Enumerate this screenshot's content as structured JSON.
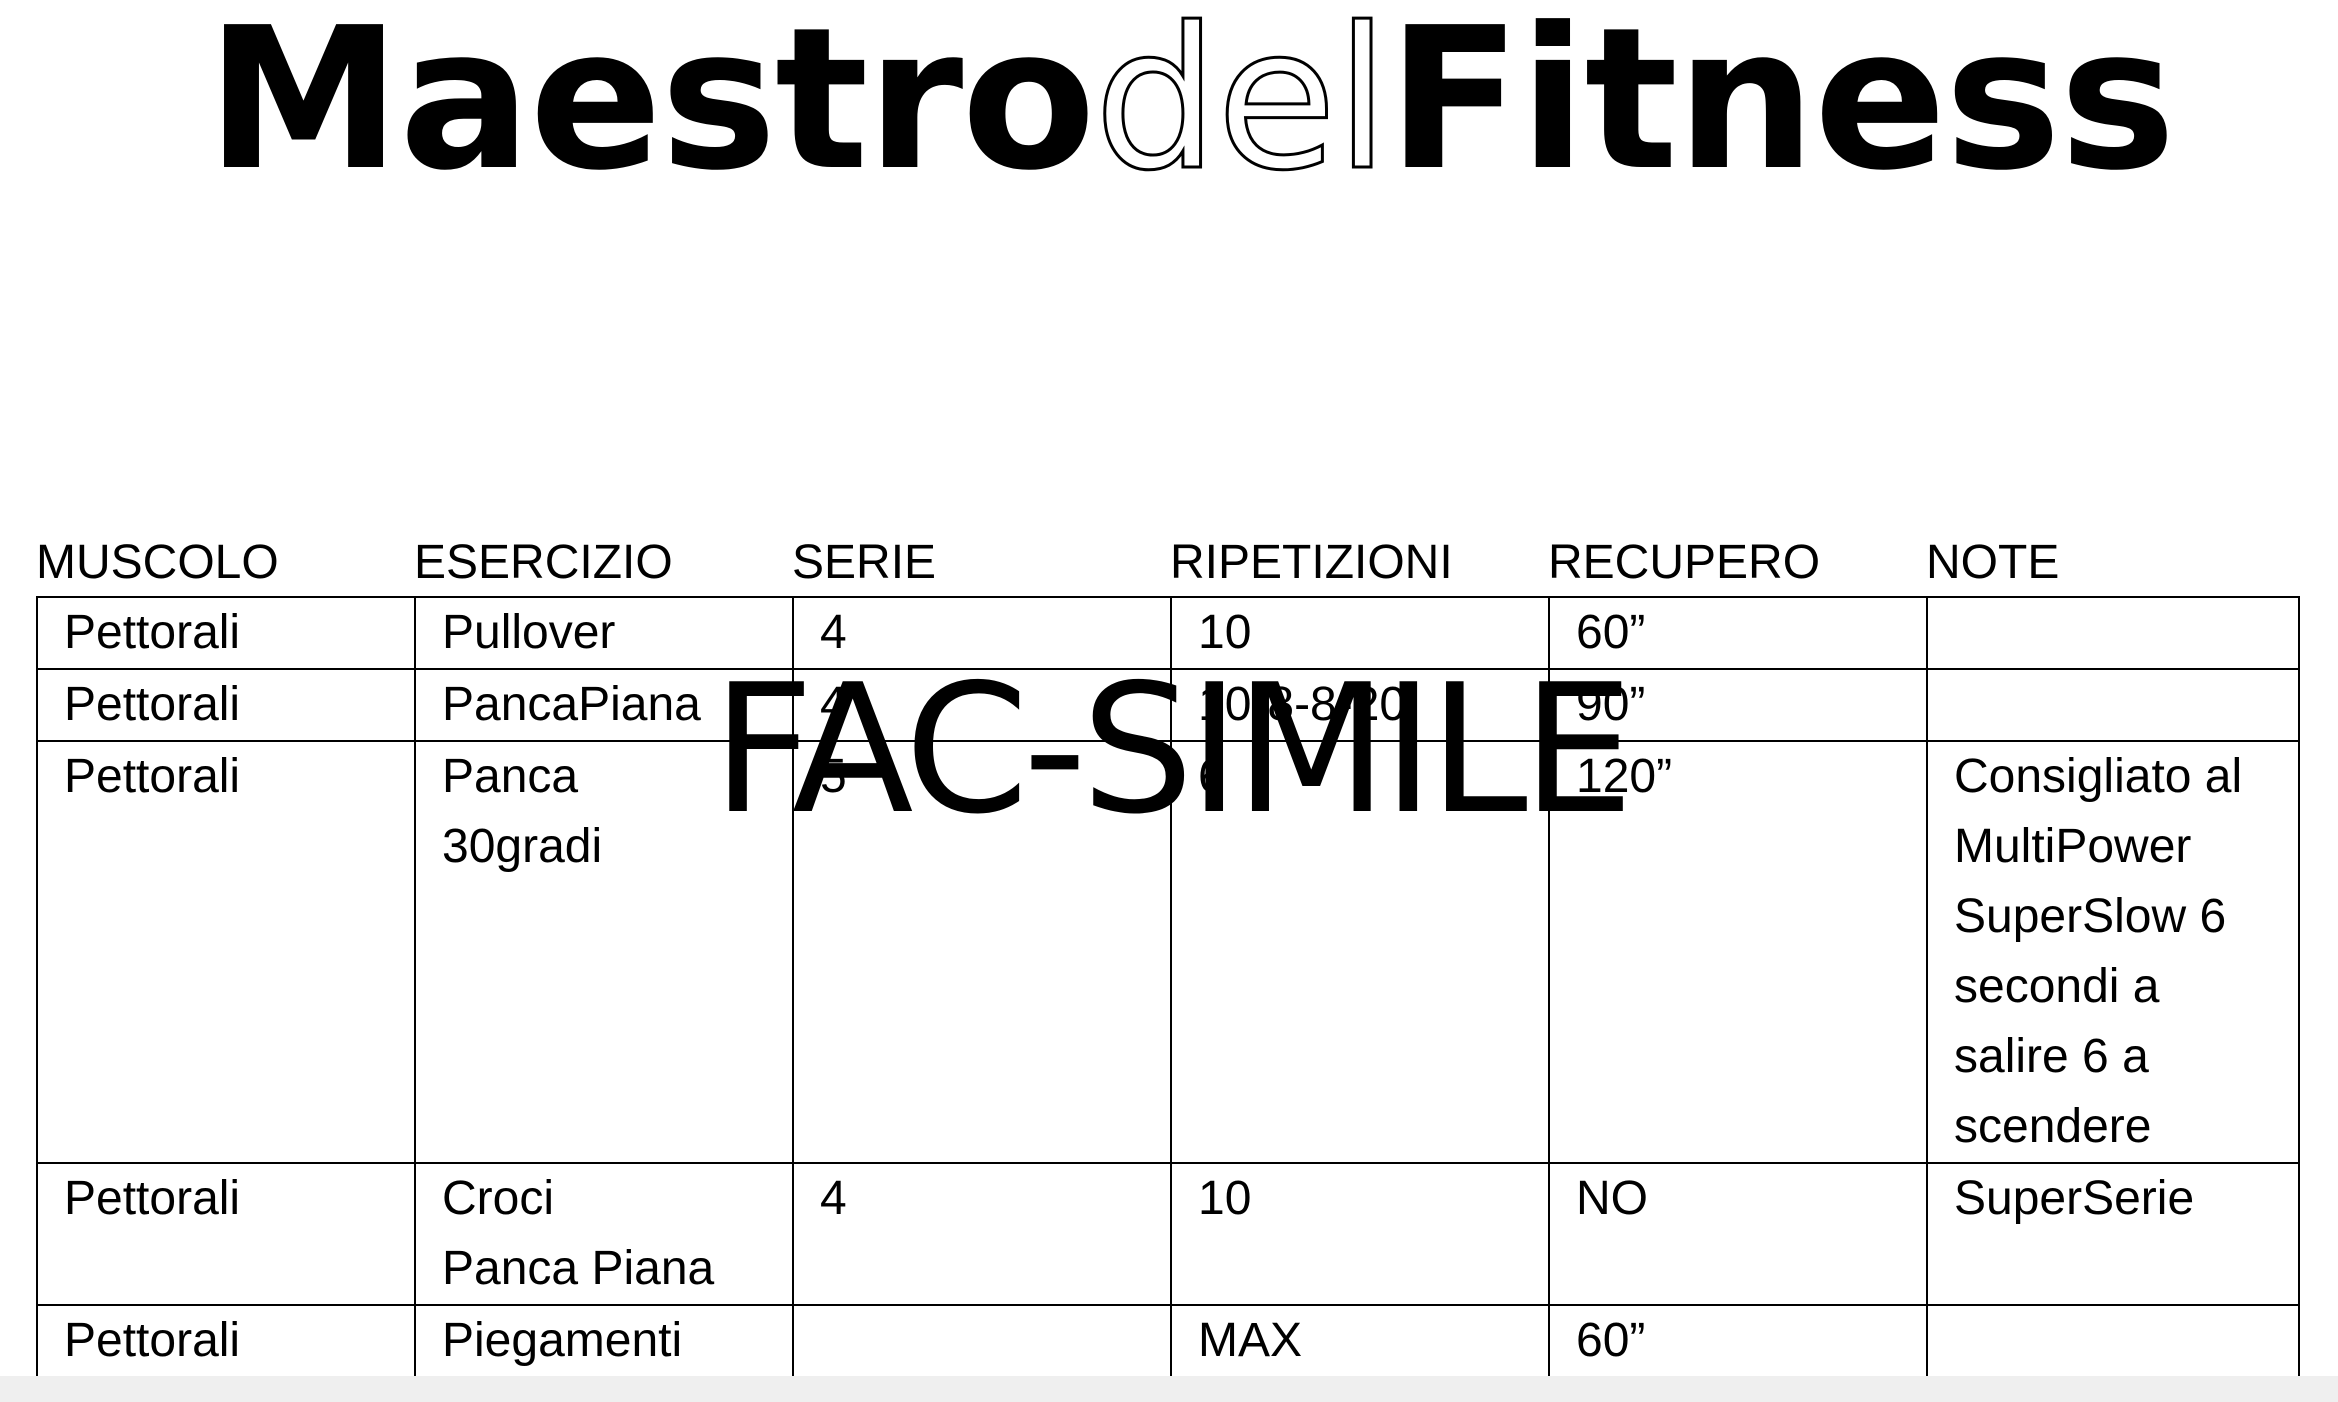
{
  "logo": {
    "part1": "Maestro",
    "part2": "del",
    "part3": "Fitness"
  },
  "table": {
    "headers": [
      "MUSCOLO",
      "ESERCIZIO",
      "SERIE",
      "RIPETIZIONI",
      "RECUPERO",
      "NOTE"
    ],
    "rows": [
      [
        "Pettorali",
        "Pullover",
        "4",
        "10",
        "60”",
        ""
      ],
      [
        "Pettorali",
        "PancaPiana",
        "4",
        "10-8-8-20",
        "90”",
        ""
      ],
      [
        "Pettorali",
        "Panca\n30gradi",
        "5",
        "6",
        "120”",
        "Consigliato al\nMultiPower\nSuperSlow 6\nsecondi a\nsalire 6 a\nscendere"
      ],
      [
        "Pettorali",
        "Croci\nPanca Piana",
        "4",
        "10",
        "NO",
        "SuperSerie"
      ],
      [
        "Pettorali",
        "Piegamenti",
        "",
        "MAX",
        "60”",
        ""
      ]
    ]
  },
  "watermark": "FAC-SIMILE"
}
